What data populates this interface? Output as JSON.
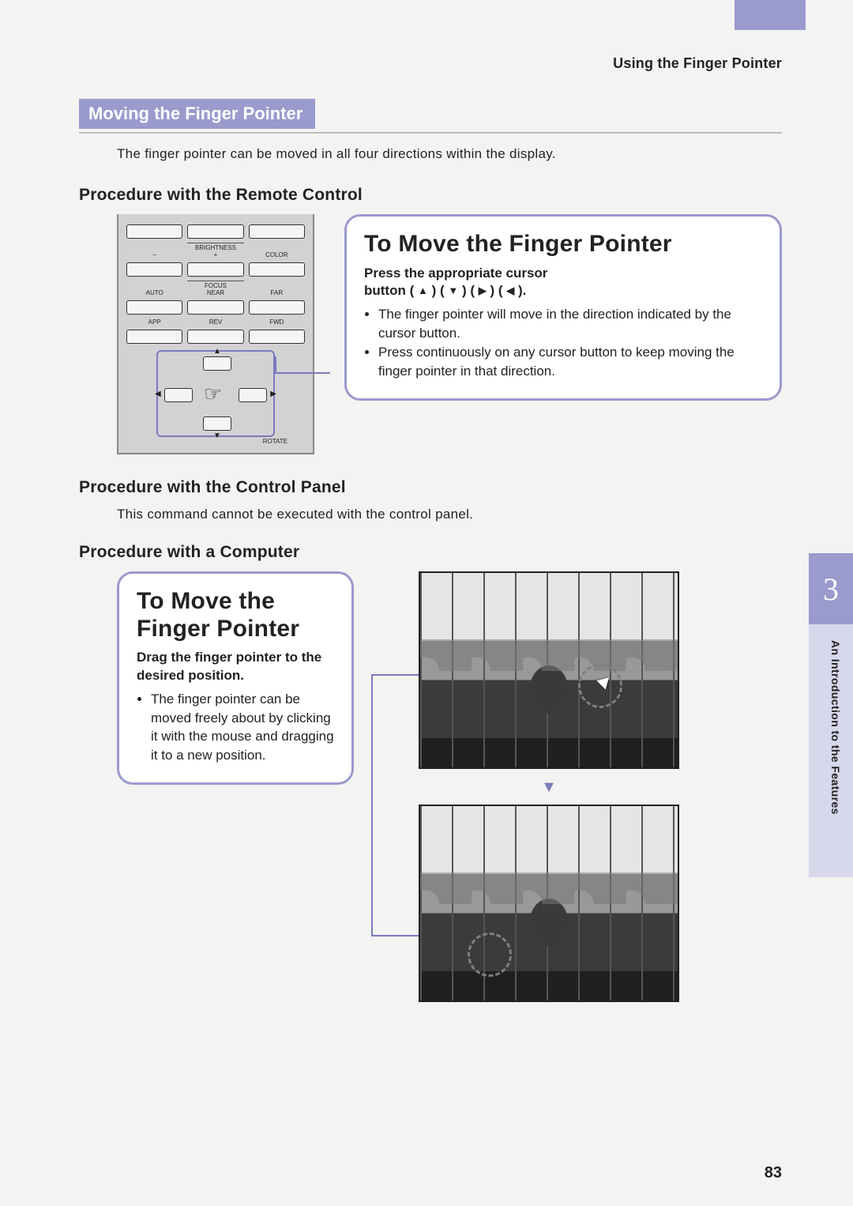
{
  "header": {
    "breadcrumb": "Using the Finger Pointer"
  },
  "section": {
    "title": "Moving the Finger Pointer",
    "lead": "The finger pointer can be moved in all four directions within the display."
  },
  "sub": {
    "remote": "Procedure with the Remote Control",
    "panel": "Procedure with the Control Panel",
    "panel_note": "This command cannot be executed with the control panel.",
    "computer": "Procedure with a Computer"
  },
  "remote_labels": {
    "brightness": "BRIGHTNESS",
    "minus": "−",
    "plus": "+",
    "color": "COLOR",
    "focus": "FOCUS",
    "auto": "AUTO",
    "near": "NEAR",
    "far": "FAR",
    "app": "APP",
    "rev": "REV",
    "fwd": "FWD",
    "rotate": "ROTATE"
  },
  "callout1": {
    "title": "To Move the Finger Pointer",
    "lead_a": "Press the appropriate cursor",
    "lead_b_prefix": "button",
    "b1": "The finger pointer will move in the direction indicated by the cursor button.",
    "b2": "Press continuously on any cursor button to keep moving the finger pointer in that direction."
  },
  "callout2": {
    "title": "To Move the Finger Pointer",
    "lead": "Drag the finger pointer to the desired position.",
    "b1": "The finger pointer can be moved freely about by clicking it with the mouse and dragging it to a new position."
  },
  "chapter": {
    "number": "3",
    "side_caption": "An Introduction to the Features"
  },
  "page_number": "83"
}
